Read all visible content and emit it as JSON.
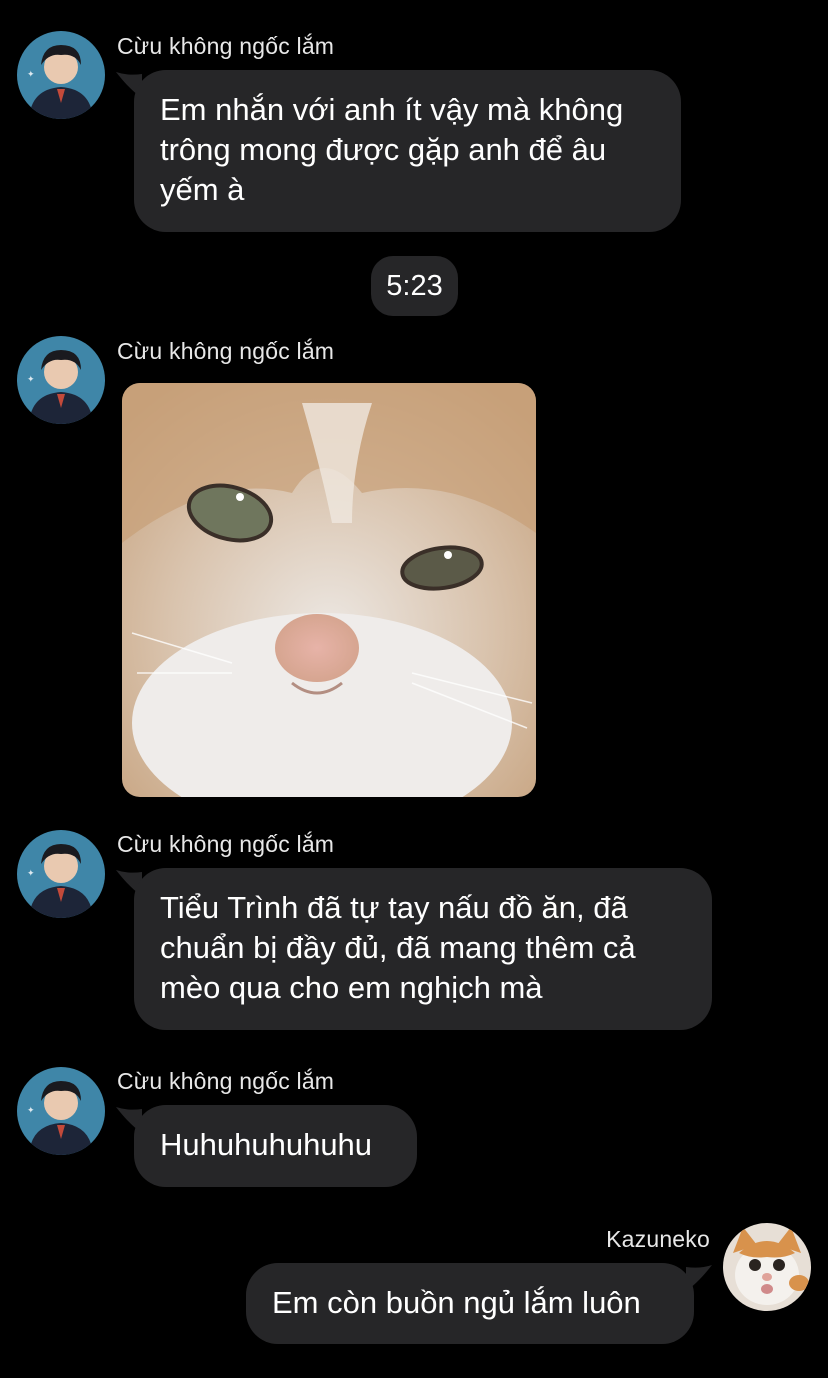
{
  "messages": [
    {
      "sender": "Cừu không ngốc lắm",
      "text": "Em nhắn với anh ít vậy mà không\ntrông mong được gặp anh để âu\nyếm à"
    },
    {
      "time_separator": "5:23"
    },
    {
      "sender": "Cừu không ngốc lắm",
      "image": "crying-cat-photo"
    },
    {
      "sender": "Cừu không ngốc lắm",
      "text": "Tiểu Trình đã tự tay nấu đồ ăn, đã\nchuẩn bị đầy đủ, đã mang thêm cả\nmèo qua cho em nghịch mà"
    },
    {
      "sender": "Cừu không ngốc lắm",
      "text": "Huhuhuhuhuhu"
    },
    {
      "sender": "Kazuneko",
      "text": "Em còn buồn ngủ lắm luôn"
    }
  ],
  "colors": {
    "background": "#000000",
    "bubble": "#262628",
    "text": "#ffffff"
  },
  "icons": {
    "other_avatar": "boy-avatar",
    "self_avatar": "cat-avatar"
  }
}
